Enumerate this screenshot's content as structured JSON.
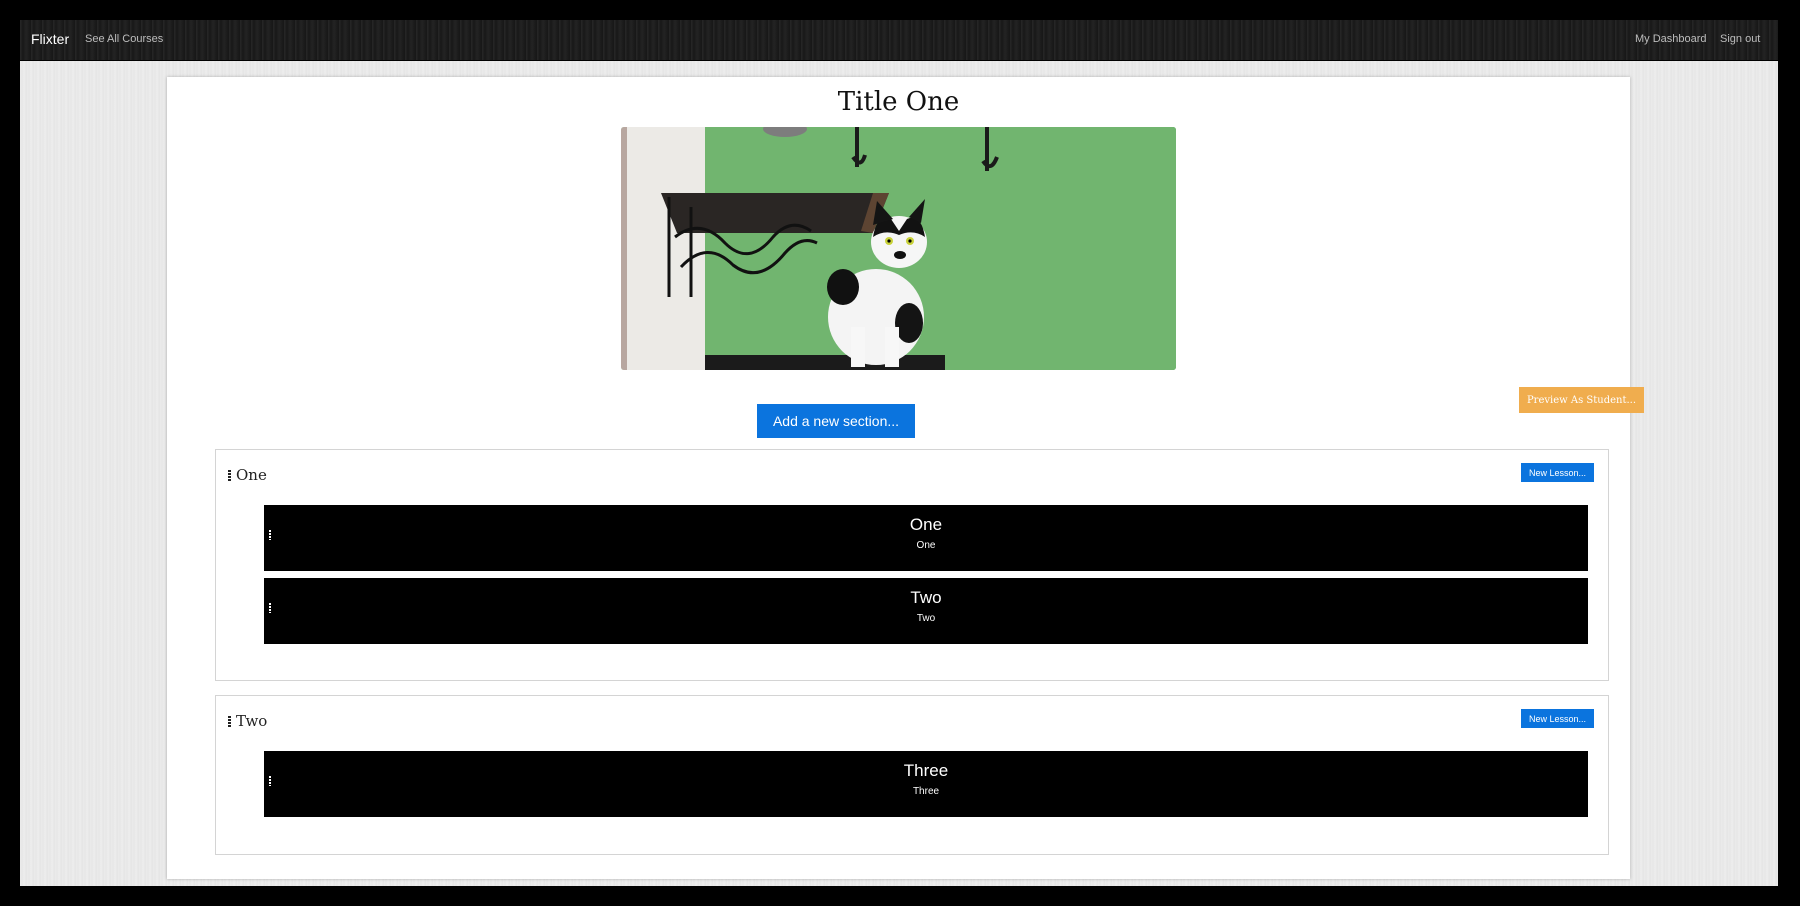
{
  "navbar": {
    "brand": "Flixter",
    "see_all_courses": "See All Courses",
    "my_dashboard": "My Dashboard",
    "sign_out": "Sign out"
  },
  "course": {
    "title": "Title One",
    "image_alt": "cat sitting beneath a shelf against a green wall"
  },
  "actions": {
    "add_section": "Add a new section...",
    "preview_as_student": "Preview As Student..."
  },
  "sections": [
    {
      "title": "One",
      "new_lesson_label": "New Lesson...",
      "lessons": [
        {
          "title": "One",
          "subtitle": "One"
        },
        {
          "title": "Two",
          "subtitle": "Two"
        }
      ]
    },
    {
      "title": "Two",
      "new_lesson_label": "New Lesson...",
      "lessons": [
        {
          "title": "Three",
          "subtitle": "Three"
        }
      ]
    }
  ],
  "colors": {
    "primary_button": "#0b74de",
    "preview_button": "#f0ad4e",
    "lesson_background": "#000000",
    "wall_green": "#6cb06a"
  }
}
